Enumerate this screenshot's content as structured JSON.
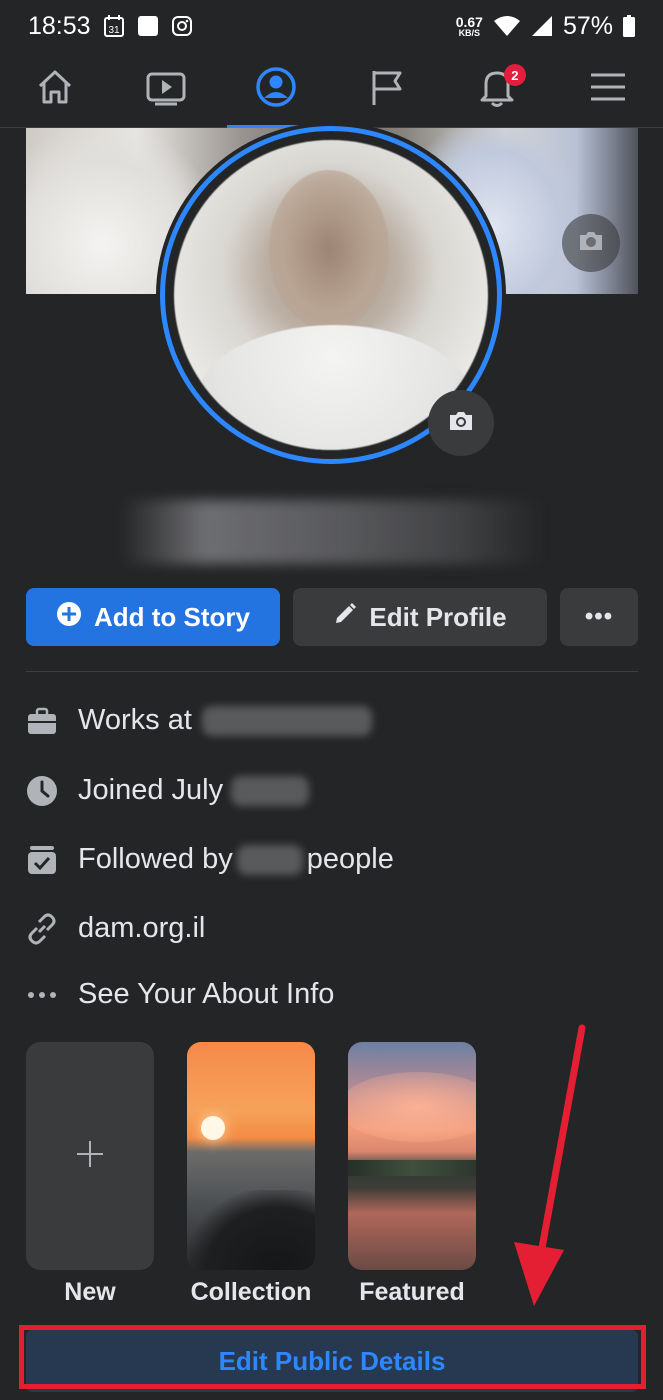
{
  "status_bar": {
    "time": "18:53",
    "calendar_day": "31",
    "net_speed_value": "0.67",
    "net_speed_unit": "KB/S",
    "battery": "57%"
  },
  "nav": {
    "items": [
      "home-icon",
      "watch-icon",
      "profile-icon",
      "pages-icon",
      "notifications-icon",
      "menu-icon"
    ],
    "active_index": 2,
    "notification_count": "2"
  },
  "actions": {
    "add_story": "Add to Story",
    "edit_profile": "Edit Profile",
    "more": "•••"
  },
  "info": {
    "works_at": "Works at",
    "joined": "Joined July",
    "followed_by": "Followed by",
    "followed_suffix": "people",
    "website": "dam.org.il",
    "see_about": "See Your About Info"
  },
  "highlights": [
    {
      "label": "New"
    },
    {
      "label": "Collection"
    },
    {
      "label": "Featured"
    }
  ],
  "edit_public_details": "Edit Public Details",
  "colors": {
    "background": "#242526",
    "accent": "#2d88ff",
    "primary_button": "#2374e1",
    "annotation_red": "#e51f33"
  }
}
